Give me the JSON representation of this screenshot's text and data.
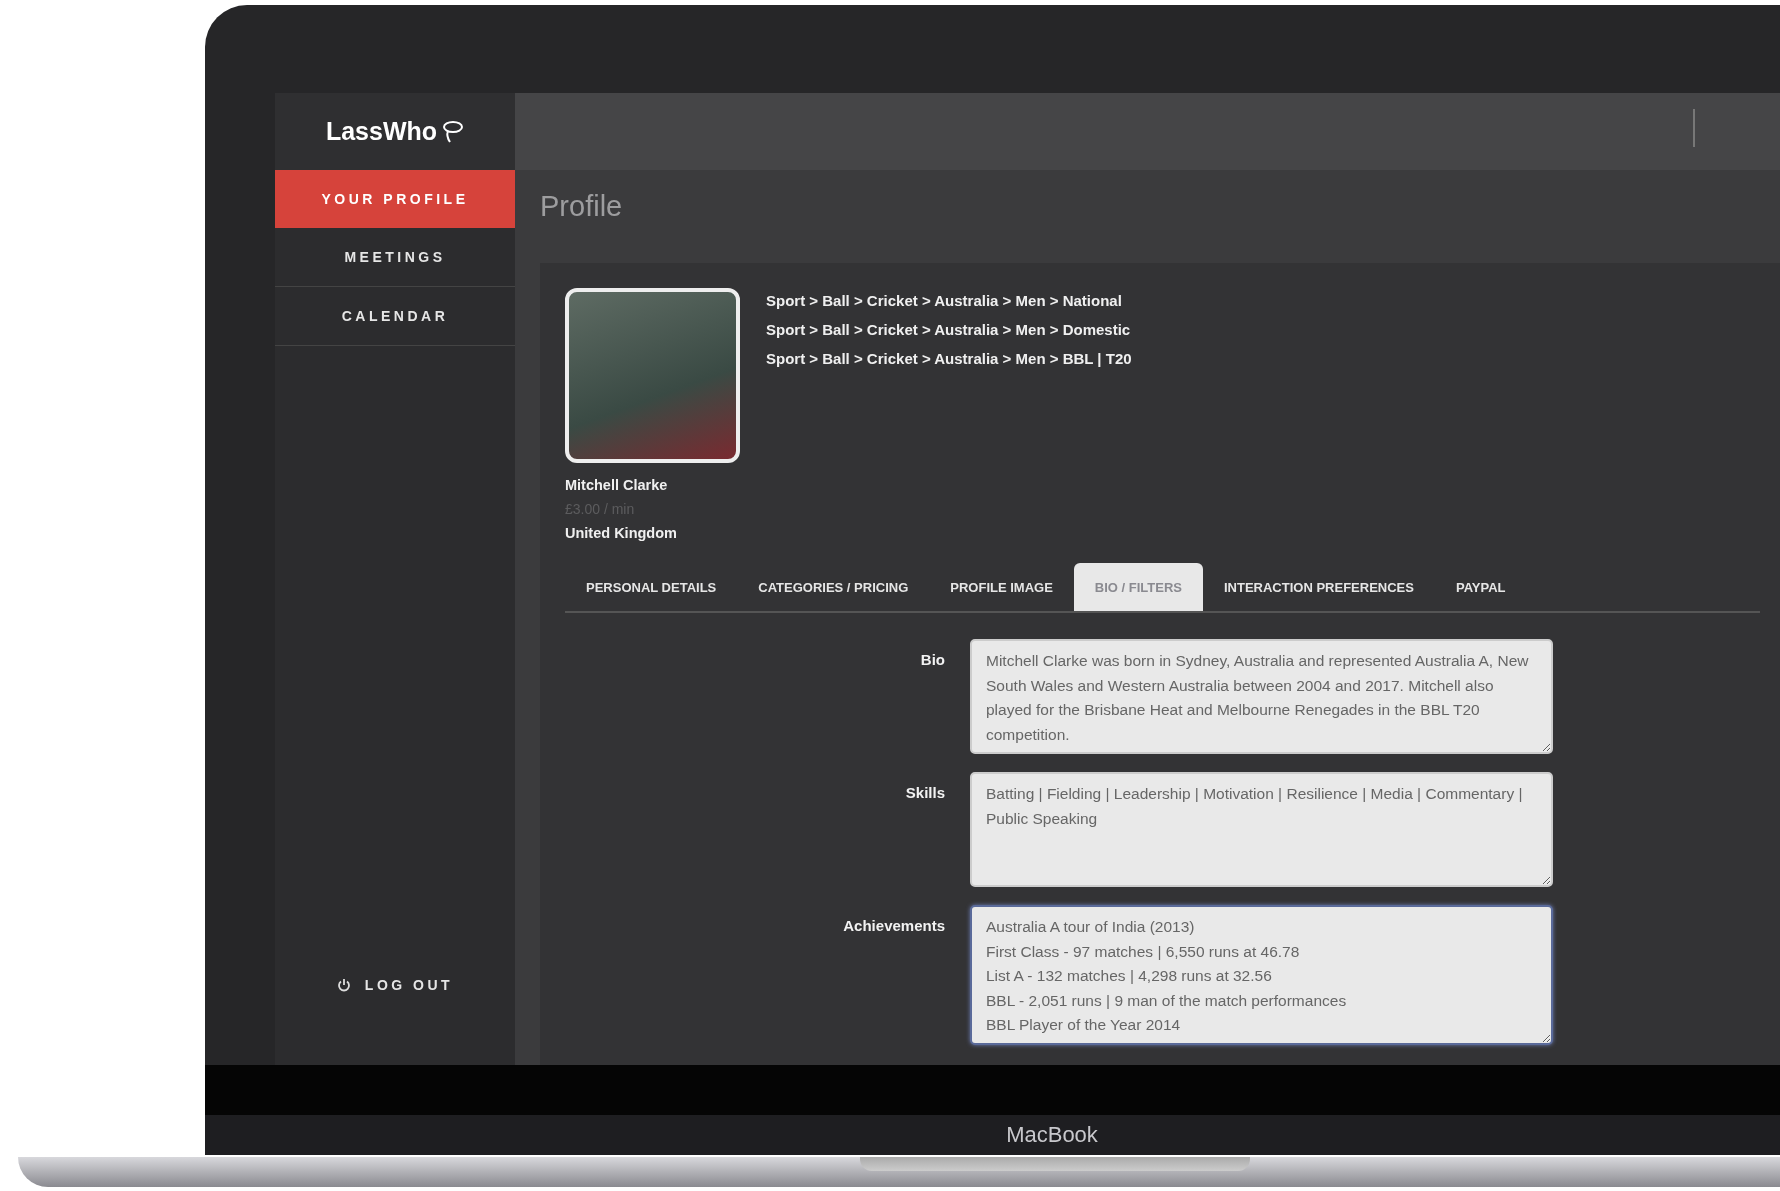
{
  "app": {
    "logo": "LassWho"
  },
  "sidebar": {
    "items": [
      {
        "label": "YOUR PROFILE",
        "selected": true
      },
      {
        "label": "MEETINGS",
        "selected": false
      },
      {
        "label": "CALENDAR",
        "selected": false
      }
    ],
    "logout": "LOG OUT"
  },
  "page": {
    "title": "Profile"
  },
  "profile": {
    "name": "Mitchell Clarke",
    "rate": "£3.00 / min",
    "country": "United Kingdom",
    "categories": [
      "Sport > Ball > Cricket > Australia > Men > National",
      "Sport > Ball > Cricket > Australia > Men > Domestic",
      "Sport > Ball > Cricket > Australia > Men > BBL | T20"
    ]
  },
  "tabs": [
    {
      "label": "PERSONAL DETAILS",
      "selected": false
    },
    {
      "label": "CATEGORIES / PRICING",
      "selected": false
    },
    {
      "label": "PROFILE IMAGE",
      "selected": false
    },
    {
      "label": "BIO / FILTERS",
      "selected": true
    },
    {
      "label": "INTERACTION PREFERENCES",
      "selected": false
    },
    {
      "label": "PAYPAL",
      "selected": false
    }
  ],
  "fields": [
    {
      "label": "Bio",
      "value": "Mitchell Clarke was born in Sydney, Australia and represented Australia A, New South Wales and Western Australia between 2004 and 2017. Mitchell also played for the Brisbane Heat and Melbourne Renegades in the BBL T20 competition.",
      "focused": false
    },
    {
      "label": "Skills",
      "value": "Batting | Fielding | Leadership | Motivation | Resilience | Media | Commentary | Public Speaking",
      "focused": false
    },
    {
      "label": "Achievements",
      "value": "Australia A tour of India (2013)\nFirst Class - 97 matches | 6,550 runs at 46.78\nList A - 132 matches | 4,298 runs at 32.56\nBBL - 2,051 runs | 9 man of the match performances\nBBL Player of the Year 2014",
      "focused": true
    }
  ],
  "device": {
    "label": "MacBook"
  }
}
